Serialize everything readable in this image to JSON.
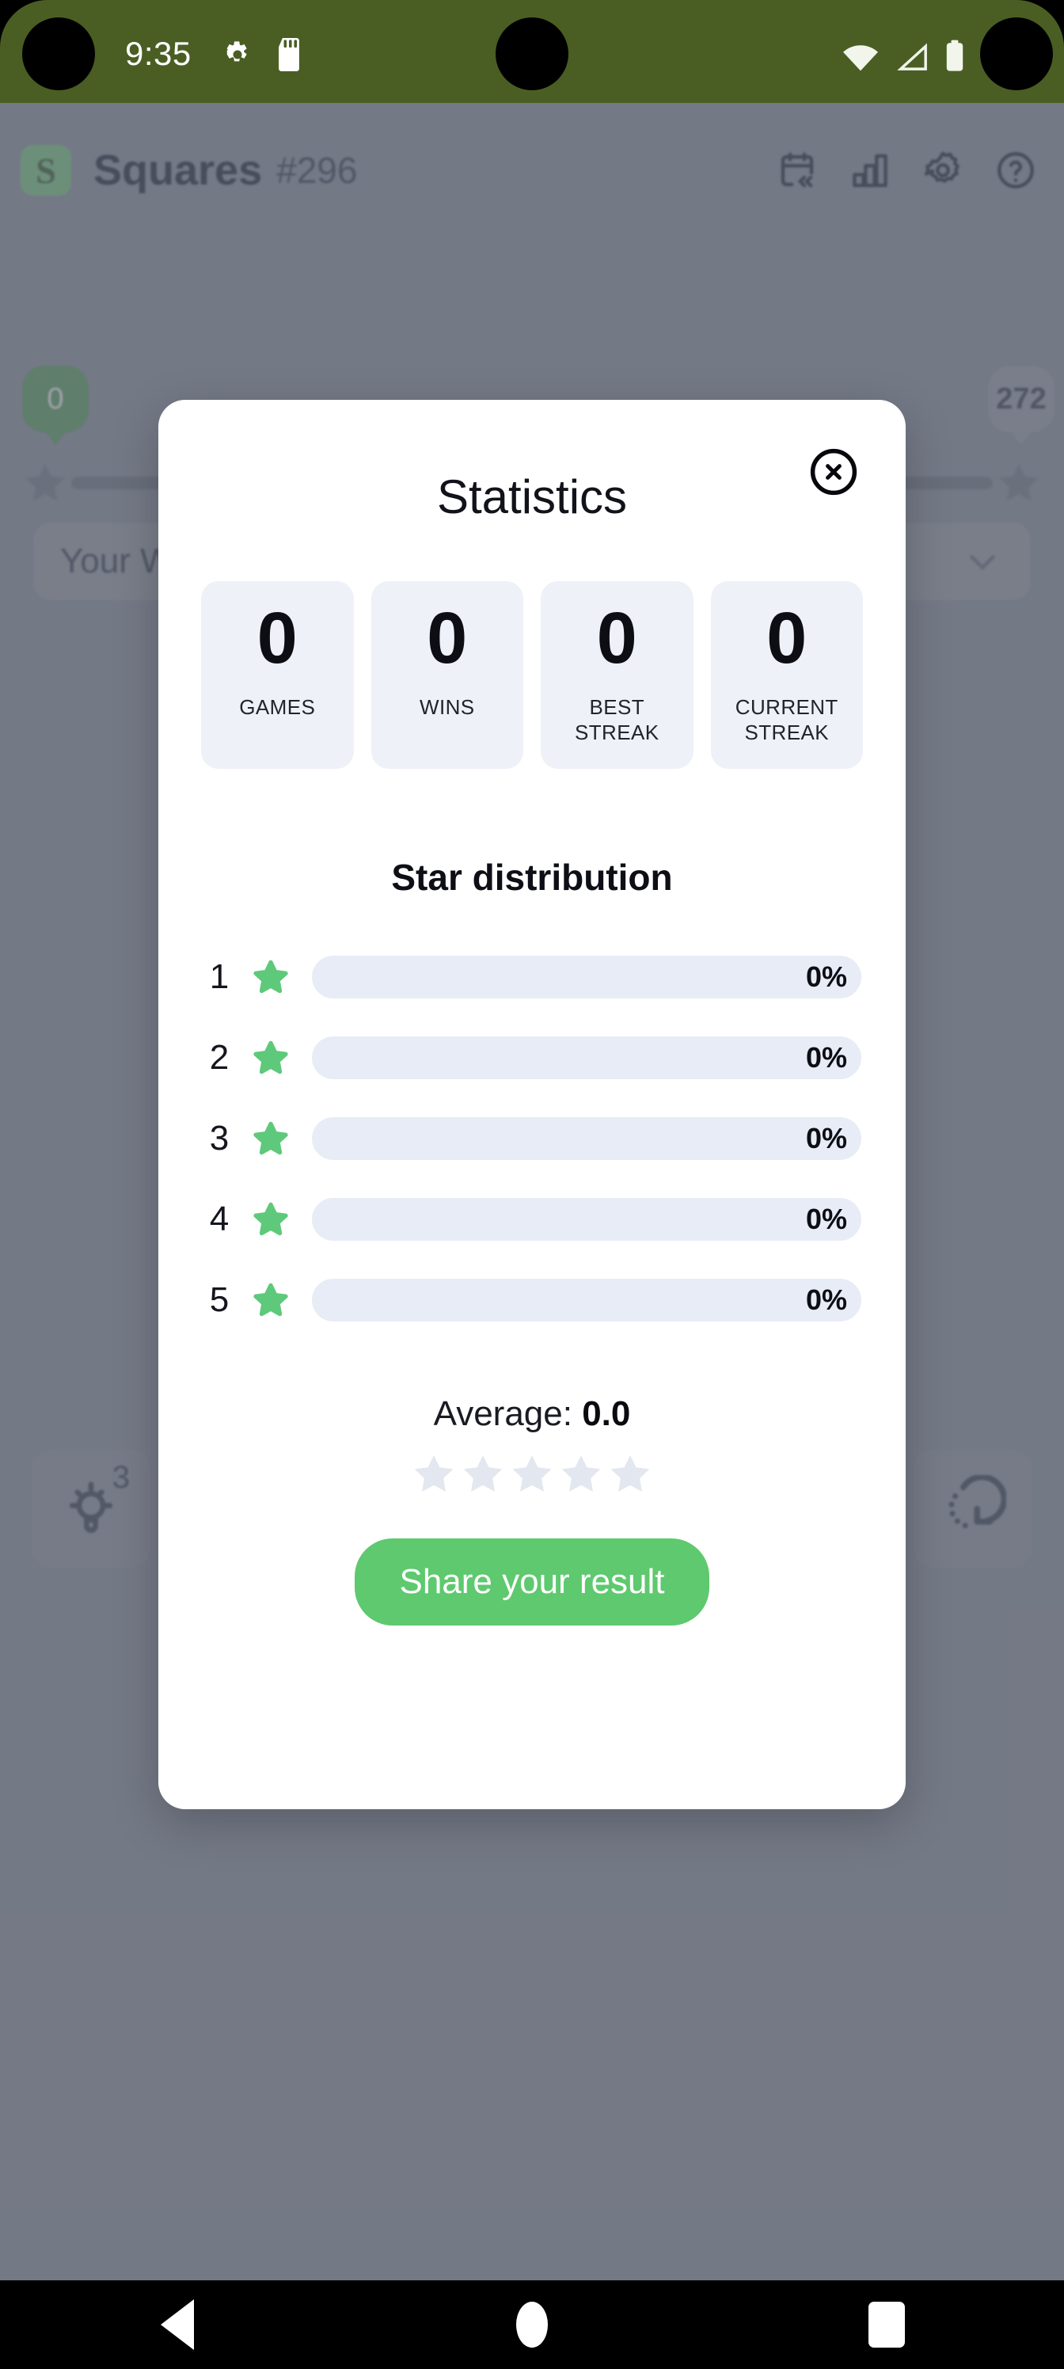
{
  "status_bar": {
    "time": "9:35",
    "left_icons": [
      "gear-icon",
      "sdcard-icon"
    ],
    "right_icons": [
      "wifi-icon",
      "cell-signal-icon",
      "battery-icon"
    ],
    "background_color": "#4a5e23"
  },
  "app": {
    "logo_letter": "S",
    "title": "Squares",
    "puzzle_number": "#296",
    "header_icons": [
      "calendar-archive-icon",
      "bar-chart-icon",
      "gear-icon",
      "help-circle-icon"
    ],
    "progress": {
      "current_label": "0",
      "total_label": "272",
      "star_count": 5
    },
    "word_select": {
      "label": "Your W",
      "chevron": "chevron-down-icon"
    },
    "actions": {
      "hint_icon": "lightbulb-icon",
      "hint_count": "3",
      "restart_icon": "rotate-restart-icon"
    }
  },
  "modal": {
    "title": "Statistics",
    "close_icon": "close-circle-icon",
    "stats": [
      {
        "value": "0",
        "label": "GAMES"
      },
      {
        "value": "0",
        "label": "WINS"
      },
      {
        "value": "0",
        "label": "BEST\nSTREAK"
      },
      {
        "value": "0",
        "label": "CURRENT\nSTREAK"
      }
    ],
    "distribution_title": "Star distribution",
    "average_prefix": "Average: ",
    "average_value": "0.0",
    "average_stars_filled": 0,
    "average_stars_total": 5,
    "share_label": "Share your result",
    "accent_color": "#5ec96e",
    "bar_track_color": "#e7ecf6"
  },
  "chart_data": {
    "type": "bar",
    "title": "Star distribution",
    "orientation": "horizontal",
    "categories": [
      "1",
      "2",
      "3",
      "4",
      "5"
    ],
    "category_icon": "star-icon",
    "values": [
      0,
      0,
      0,
      0,
      0
    ],
    "value_labels": [
      "0%",
      "0%",
      "0%",
      "0%",
      "0%"
    ],
    "unit": "%",
    "xlabel": "",
    "ylabel": "Stars",
    "xlim": [
      0,
      100
    ],
    "grid": false,
    "legend": "none",
    "bar_color": "#5ec97a",
    "track_color": "#e7ecf6",
    "annotations": [
      "Average: 0.0"
    ]
  },
  "nav_bar": {
    "buttons": [
      "back-button",
      "home-button",
      "recents-button"
    ]
  }
}
